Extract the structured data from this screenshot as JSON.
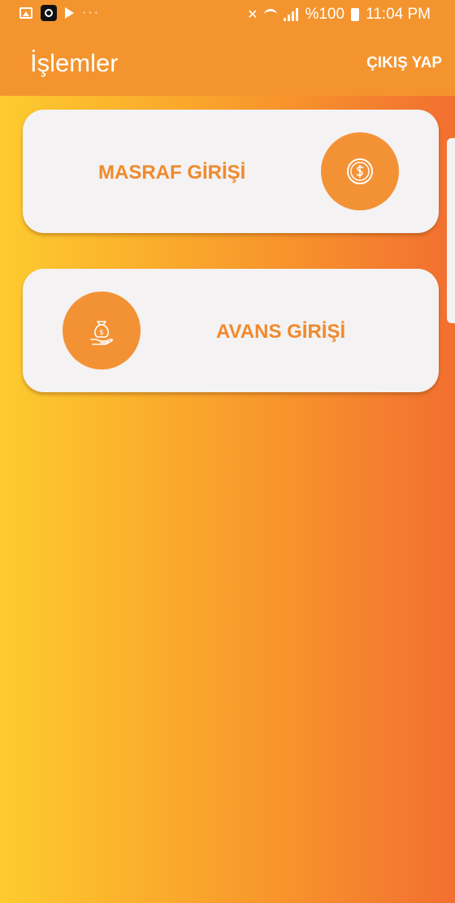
{
  "status_bar": {
    "dots": "···",
    "battery_text": "%100",
    "time": "11:04 PM",
    "icons": [
      "gallery-icon",
      "app-icon",
      "play-icon",
      "mute-icon",
      "wifi-icon",
      "signal-icon",
      "battery-icon"
    ]
  },
  "header": {
    "title": "İşlemler",
    "logout_label": "ÇIKIŞ YAP"
  },
  "cards": [
    {
      "label": "MASRAF GİRİŞİ",
      "icon": "coin-dollar-icon"
    },
    {
      "label": "AVANS GİRİŞİ",
      "icon": "money-bag-hand-icon"
    }
  ],
  "colors": {
    "accent": "#f39235",
    "header": "#f4942e",
    "card": "#f4f2f3",
    "gradient_start": "#fdcb2f",
    "gradient_end": "#f26f30"
  }
}
